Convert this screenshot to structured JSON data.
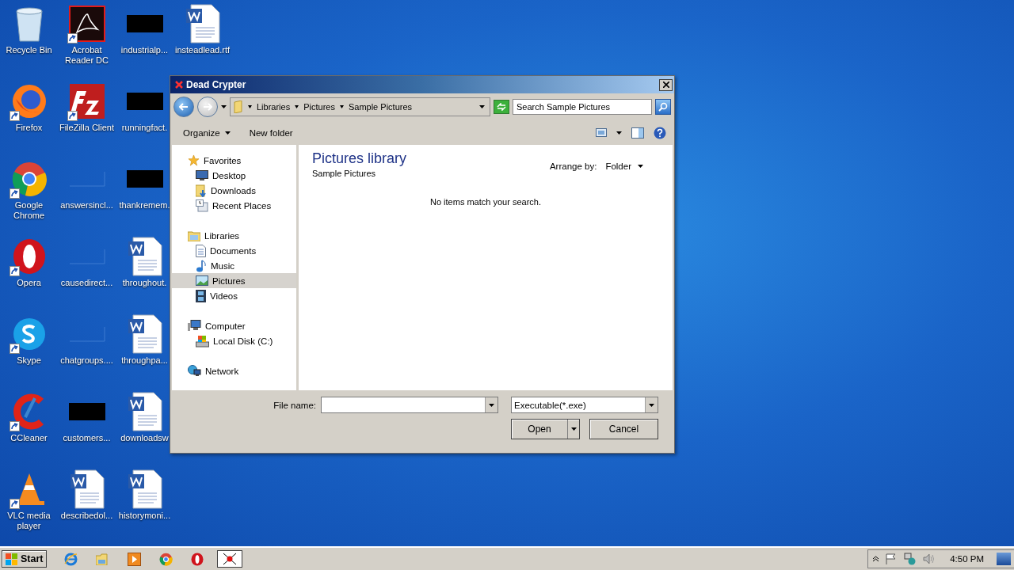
{
  "desktop_icons": [
    {
      "label": "Recycle Bin",
      "kind": "recycle",
      "shortcut": false
    },
    {
      "label": "Firefox",
      "kind": "firefox",
      "shortcut": true
    },
    {
      "label": "Google Chrome",
      "kind": "chrome",
      "shortcut": true
    },
    {
      "label": "Opera",
      "kind": "opera",
      "shortcut": true
    },
    {
      "label": "Skype",
      "kind": "skype",
      "shortcut": true
    },
    {
      "label": "CCleaner",
      "kind": "ccleaner",
      "shortcut": true
    },
    {
      "label": "VLC media player",
      "kind": "vlc",
      "shortcut": true
    },
    {
      "label": "Acrobat Reader DC",
      "kind": "acrobat",
      "shortcut": true
    },
    {
      "label": "FileZilla Client",
      "kind": "filezilla",
      "shortcut": true
    },
    {
      "label": "answersincl...",
      "kind": "blank",
      "shortcut": false
    },
    {
      "label": "causedirect...",
      "kind": "blank",
      "shortcut": false
    },
    {
      "label": "chatgroups....",
      "kind": "blank",
      "shortcut": false
    },
    {
      "label": "customers...",
      "kind": "redacted",
      "shortcut": false
    },
    {
      "label": "describedol...",
      "kind": "word",
      "shortcut": false
    },
    {
      "label": "industrialp...",
      "kind": "redacted",
      "shortcut": false
    },
    {
      "label": "runningfact.",
      "kind": "redacted",
      "shortcut": false
    },
    {
      "label": "thankremem.",
      "kind": "redacted",
      "shortcut": false
    },
    {
      "label": "throughout.",
      "kind": "word",
      "shortcut": false
    },
    {
      "label": "throughpa...",
      "kind": "word",
      "shortcut": false
    },
    {
      "label": "downloadsw",
      "kind": "word",
      "shortcut": false
    },
    {
      "label": "historymoni...",
      "kind": "word",
      "shortcut": false
    },
    {
      "label": "insteadlead.rtf",
      "kind": "word",
      "shortcut": false
    }
  ],
  "dialog": {
    "title": "Dead Crypter",
    "breadcrumb": [
      "Libraries",
      "Pictures",
      "Sample Pictures"
    ],
    "search": {
      "placeholder": "Search Sample Pictures"
    },
    "toolbar": {
      "organize": "Organize",
      "new_folder": "New folder"
    },
    "nav": [
      {
        "label": "Favorites",
        "kind": "star",
        "selected": false,
        "children": [
          {
            "label": "Desktop",
            "kind": "desktop",
            "selected": false
          },
          {
            "label": "Downloads",
            "kind": "downloads",
            "selected": false
          },
          {
            "label": "Recent Places",
            "kind": "recent",
            "selected": false
          }
        ]
      },
      {
        "label": "Libraries",
        "kind": "libraries",
        "selected": false,
        "children": [
          {
            "label": "Documents",
            "kind": "documents",
            "selected": false
          },
          {
            "label": "Music",
            "kind": "music",
            "selected": false
          },
          {
            "label": "Pictures",
            "kind": "pictures",
            "selected": true
          },
          {
            "label": "Videos",
            "kind": "videos",
            "selected": false
          }
        ]
      },
      {
        "label": "Computer",
        "kind": "computer",
        "selected": false,
        "children": [
          {
            "label": "Local Disk (C:)",
            "kind": "disk",
            "selected": false
          }
        ]
      },
      {
        "label": "Network",
        "kind": "network",
        "selected": false
      }
    ],
    "library": {
      "title": "Pictures library",
      "subtitle": "Sample Pictures",
      "arrange_label": "Arrange by:",
      "arrange_value": "Folder"
    },
    "empty_message": "No items match your search.",
    "file_name": {
      "label": "File name:"
    },
    "file_type": "Executable(*.exe)",
    "buttons": {
      "open": "Open",
      "cancel": "Cancel"
    }
  },
  "taskbar": {
    "start": "Start",
    "apps": [
      {
        "kind": "ie",
        "selected": false
      },
      {
        "kind": "explorer",
        "selected": false
      },
      {
        "kind": "media",
        "selected": false
      },
      {
        "kind": "chrome",
        "selected": false
      },
      {
        "kind": "opera",
        "selected": false
      },
      {
        "kind": "crypter",
        "selected": true
      }
    ],
    "clock": "4:50 PM"
  }
}
